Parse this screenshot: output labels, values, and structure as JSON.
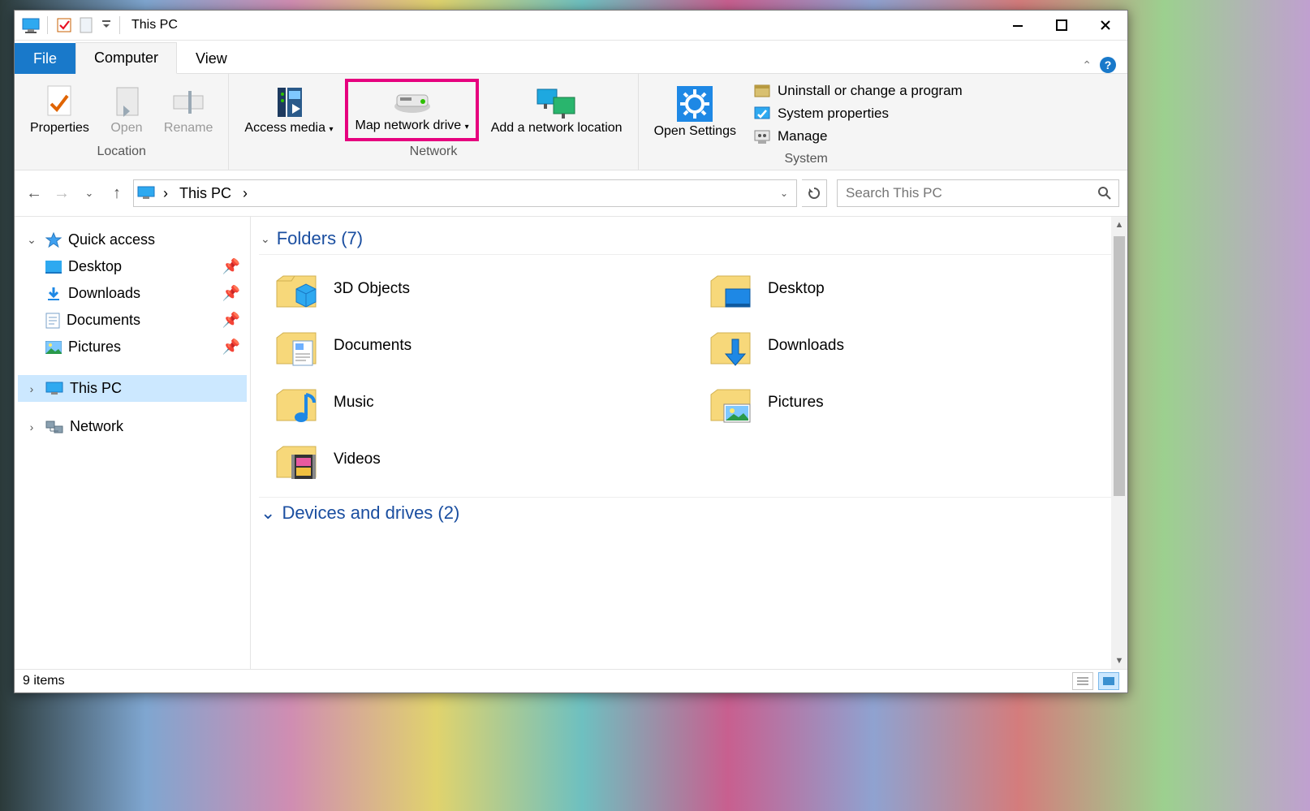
{
  "window": {
    "title": "This PC",
    "controls": {
      "minimize": "minimize",
      "maximize": "maximize",
      "close": "close"
    }
  },
  "tabs": {
    "file": "File",
    "computer": "Computer",
    "view": "View"
  },
  "ribbon": {
    "location": {
      "label": "Location",
      "properties": "Properties",
      "open": "Open",
      "rename": "Rename"
    },
    "network": {
      "label": "Network",
      "access_media": "Access media",
      "map_drive": "Map network drive",
      "add_network": "Add a network location"
    },
    "system": {
      "label": "System",
      "open_settings": "Open Settings",
      "uninstall": "Uninstall or change a program",
      "system_properties": "System properties",
      "manage": "Manage"
    }
  },
  "address": {
    "root": "",
    "crumb": "This PC",
    "search_placeholder": "Search This PC"
  },
  "tree": {
    "quick_access": "Quick access",
    "desktop": "Desktop",
    "downloads": "Downloads",
    "documents": "Documents",
    "pictures": "Pictures",
    "this_pc": "This PC",
    "network": "Network"
  },
  "sections": {
    "folders_label": "Folders (7)",
    "devices_label": "Devices and drives (2)"
  },
  "folders": [
    {
      "name": "3D Objects"
    },
    {
      "name": "Desktop"
    },
    {
      "name": "Documents"
    },
    {
      "name": "Downloads"
    },
    {
      "name": "Music"
    },
    {
      "name": "Pictures"
    },
    {
      "name": "Videos"
    }
  ],
  "status": {
    "items": "9 items"
  }
}
